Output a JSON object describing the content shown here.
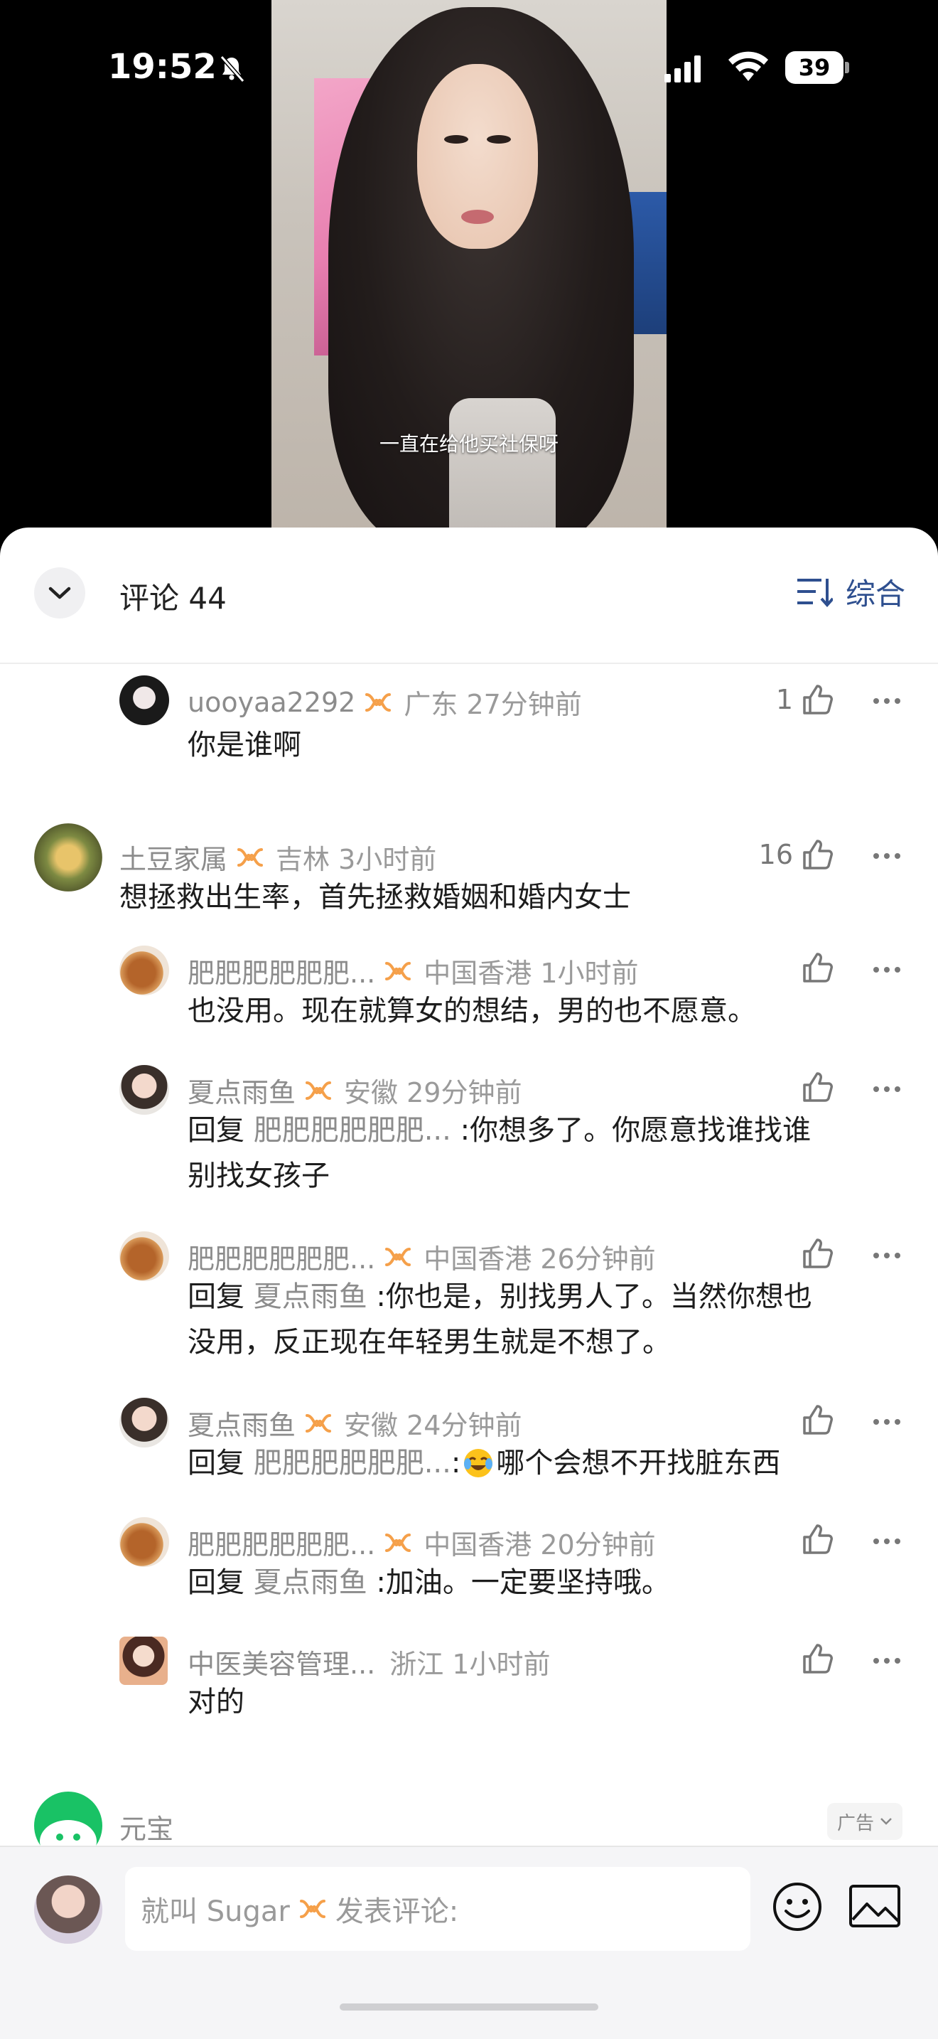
{
  "status_bar": {
    "time": "19:52",
    "battery": "39"
  },
  "video": {
    "subtitle": "一直在给他买社保呀"
  },
  "header": {
    "title": "评论 44",
    "sort_label": "综合"
  },
  "comments": [
    {
      "name": "uooyaa2292",
      "location": "广东 27分钟前",
      "likes": "1",
      "text": "你是谁啊"
    },
    {
      "name": "土豆家属",
      "location": "吉林 3小时前",
      "likes": "16",
      "text": "想拯救出生率，首先拯救婚姻和婚内女士"
    },
    {
      "name": "肥肥肥肥肥肥...",
      "location": "中国香港 1小时前",
      "likes": "",
      "text": "也没用。现在就算女的想结，男的也不愿意。"
    },
    {
      "name": "夏点雨鱼",
      "location": "安徽 29分钟前",
      "likes": "",
      "reply_prefix": "回复 ",
      "reply_to": "肥肥肥肥肥肥...",
      "text_line1": " :你想多了。你愿意找谁找谁",
      "text_line2": "别找女孩子"
    },
    {
      "name": "肥肥肥肥肥肥...",
      "location": "中国香港 26分钟前",
      "likes": "",
      "reply_prefix": "回复 ",
      "reply_to": "夏点雨鱼",
      "text_line1": " :你也是，别找男人了。当然你想也",
      "text_line2": "没用，反正现在年轻男生就是不想了。"
    },
    {
      "name": "夏点雨鱼",
      "location": "安徽 24分钟前",
      "likes": "",
      "reply_prefix": "回复 ",
      "reply_to": "肥肥肥肥肥肥...",
      "text_line1": " :",
      "text_line2": "哪个会想不开找脏东西"
    },
    {
      "name": "肥肥肥肥肥肥...",
      "location": "中国香港 20分钟前",
      "likes": "",
      "reply_prefix": "回复 ",
      "reply_to": "夏点雨鱼",
      "text_line1": " :加油。一定要坚持哦。"
    },
    {
      "name": "中医美容管理...",
      "location": "浙江 1小时前",
      "likes": "",
      "text": "对的"
    }
  ],
  "ad": {
    "name": "元宝",
    "tag": "广告"
  },
  "composer": {
    "user_name": "就叫 Sugar",
    "suffix": "发表评论:"
  },
  "colors": {
    "accent": "#2e4f8f",
    "badge_orange": "#f5a04a",
    "ad_green": "#19c265"
  }
}
